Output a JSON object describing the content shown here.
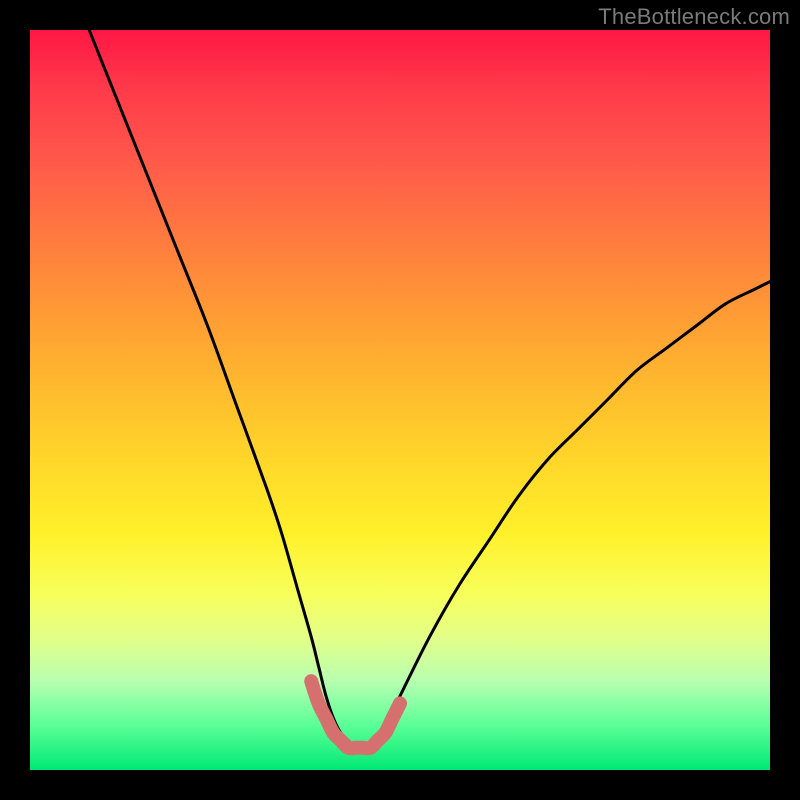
{
  "watermark": {
    "text": "TheBottleneck.com"
  },
  "colors": {
    "curve_stroke": "#000000",
    "highlight_stroke": "#d6706f",
    "background_frame": "#000000"
  },
  "chart_data": {
    "type": "line",
    "title": "",
    "xlabel": "",
    "ylabel": "",
    "xlim": [
      0,
      100
    ],
    "ylim": [
      0,
      100
    ],
    "grid": false,
    "legend_position": "none",
    "series": [
      {
        "name": "bottleneck-curve",
        "x": [
          8,
          12,
          16,
          20,
          24,
          28,
          32,
          34,
          36,
          38,
          39,
          40,
          41,
          42,
          43,
          44,
          45,
          46,
          47,
          48,
          50,
          54,
          58,
          62,
          66,
          70,
          74,
          78,
          82,
          86,
          90,
          94,
          98,
          100
        ],
        "y": [
          100,
          90,
          80,
          70,
          60,
          49,
          38,
          32,
          25,
          18,
          14,
          10,
          7,
          5,
          4,
          3,
          3,
          3,
          4,
          6,
          10,
          18,
          25,
          31,
          37,
          42,
          46,
          50,
          54,
          57,
          60,
          63,
          65,
          66
        ]
      },
      {
        "name": "bottleneck-floor-highlight",
        "x": [
          38,
          39,
          40,
          41,
          42,
          43,
          44,
          45,
          46,
          47,
          48,
          49,
          50
        ],
        "y": [
          12,
          9,
          7,
          5,
          4,
          3,
          3,
          3,
          3,
          4,
          5,
          7,
          9
        ]
      }
    ],
    "annotations": []
  }
}
